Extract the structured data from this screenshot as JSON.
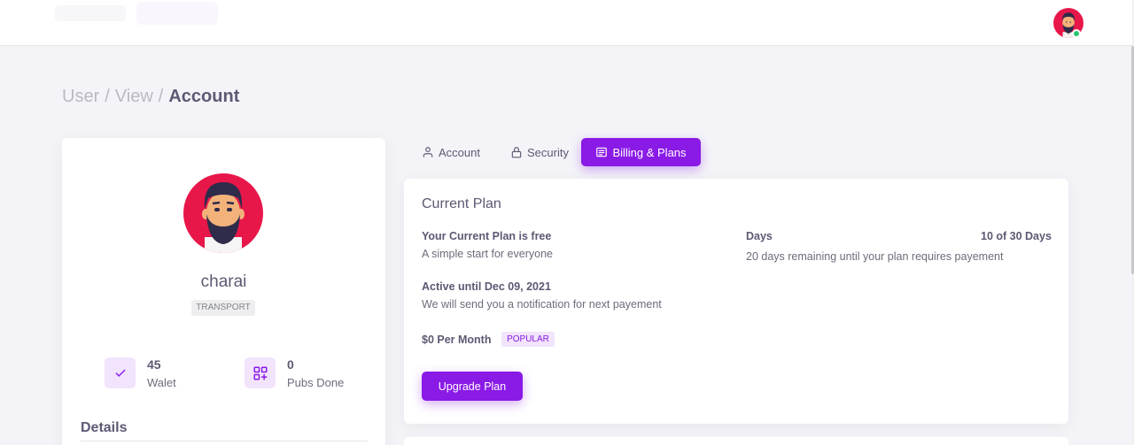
{
  "breadcrumb": {
    "items": [
      "User",
      "View"
    ],
    "separator": "/",
    "current": "Account"
  },
  "profile": {
    "name": "charai",
    "role": "TRANSPORT",
    "stats": [
      {
        "value": "45",
        "label": "Walet",
        "icon": "check-icon"
      },
      {
        "value": "0",
        "label": "Pubs Done",
        "icon": "grid-plus-icon"
      }
    ],
    "details_title": "Details"
  },
  "tabs": [
    {
      "label": "Account",
      "icon": "user-icon",
      "active": false
    },
    {
      "label": "Security",
      "icon": "lock-icon",
      "active": false
    },
    {
      "label": "Billing & Plans",
      "icon": "bookmark-icon",
      "active": true
    }
  ],
  "plan": {
    "title": "Current Plan",
    "current_plan_title": "Your Current Plan is free",
    "current_plan_desc": "A simple start for everyone",
    "active_until_title": "Active until Dec 09, 2021",
    "active_until_desc": "We will send you a notification for next payement",
    "price": "$0 Per Month",
    "badge": "POPULAR",
    "days_label": "Days",
    "days_value": "10 of 30 Days",
    "days_desc": "20 days remaining until your plan requires payement",
    "upgrade_button": "Upgrade Plan"
  },
  "colors": {
    "primary": "#8a1ae6",
    "avatar_bg": "#e8174a",
    "online": "#28c76f"
  }
}
